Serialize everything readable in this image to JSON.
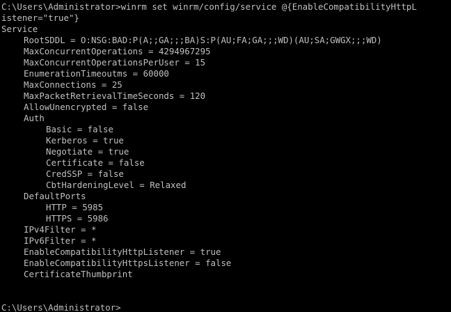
{
  "console": {
    "colors": {
      "background": "#000000",
      "foreground": "#c0c0c0"
    },
    "command_line_1": "C:\\Users\\Administrator>winrm set winrm/config/service @{EnableCompatibilityHttpL",
    "command_line_2": "istener=\"true\"}",
    "output": {
      "section": "Service",
      "root_sddl": "RootSDDL = O:NSG:BAD:P(A;;GA;;;BA)S:P(AU;FA;GA;;;WD)(AU;SA;GWGX;;;WD)",
      "max_concurrent_operations": "MaxConcurrentOperations = 4294967295",
      "max_concurrent_operations_per_user": "MaxConcurrentOperationsPerUser = 15",
      "enumeration_timeoutms": "EnumerationTimeoutms = 60000",
      "max_connections": "MaxConnections = 25",
      "max_packet_retrieval_time": "MaxPacketRetrievalTimeSeconds = 120",
      "allow_unencrypted": "AllowUnencrypted = false",
      "auth_header": "Auth",
      "auth": {
        "basic": "Basic = false",
        "kerberos": "Kerberos = true",
        "negotiate": "Negotiate = true",
        "certificate": "Certificate = false",
        "credssp": "CredSSP = false",
        "cbt_hardening": "CbtHardeningLevel = Relaxed"
      },
      "default_ports_header": "DefaultPorts",
      "default_ports": {
        "http": "HTTP = 5985",
        "https": "HTTPS = 5986"
      },
      "ipv4_filter": "IPv4Filter = *",
      "ipv6_filter": "IPv6Filter = *",
      "compat_http_listener": "EnableCompatibilityHttpListener = true",
      "compat_https_listener": "EnableCompatibilityHttpsListener = false",
      "certificate_thumbprint": "CertificateThumbprint"
    },
    "prompt": "C:\\Users\\Administrator>"
  }
}
